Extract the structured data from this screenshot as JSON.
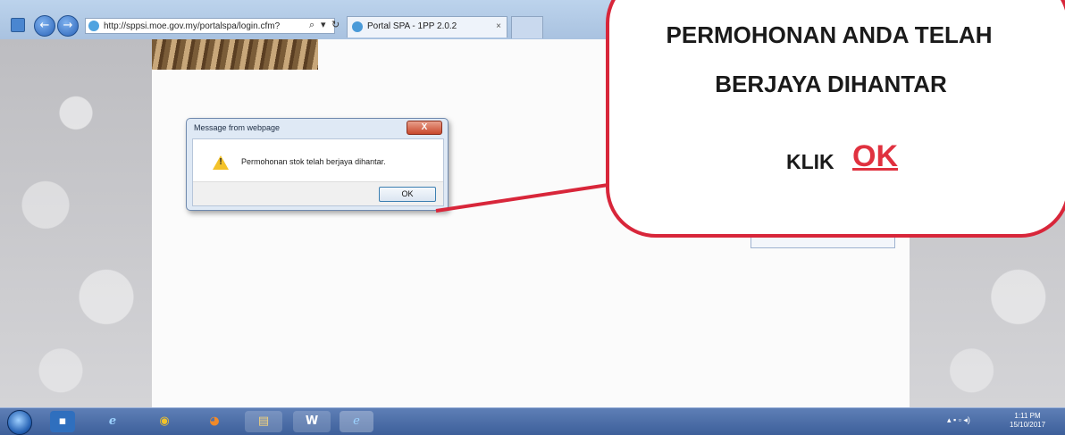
{
  "browser": {
    "address": "http://sppsi.moe.gov.my/portalspa/login.cfm?",
    "tab_title": "Portal SPA - 1PP 2.0.2",
    "tab_close": "×",
    "back_glyph": "←",
    "forward_glyph": "→",
    "search_glyph": "⌕",
    "refresh_glyph": "↻",
    "dropdown_glyph": "▾"
  },
  "dialog": {
    "title": "Message from webpage",
    "close_label": "X",
    "message": "Permohonan stok telah berjaya dihantar.",
    "warning_mark": "!",
    "ok_label": "OK"
  },
  "callout": {
    "line1": "PERMOHONAN ANDA TELAH",
    "line2": "BERJAYA DIHANTAR",
    "klik": "KLIK",
    "ok": "OK",
    "border_color": "#d8263a",
    "ok_color": "#e0313f"
  },
  "taskbar": {
    "apps": [
      {
        "name": "show-desktop-icon",
        "glyph": "▪"
      },
      {
        "name": "internet-explorer-icon",
        "glyph": "e"
      },
      {
        "name": "chrome-icon",
        "glyph": "◉"
      },
      {
        "name": "firefox-icon",
        "glyph": "◕"
      },
      {
        "name": "file-explorer-icon",
        "glyph": "▤"
      },
      {
        "name": "word-icon",
        "glyph": "W"
      },
      {
        "name": "ie-window-icon",
        "glyph": "e"
      }
    ],
    "time": "1:11 PM",
    "date": "15/10/2017"
  }
}
